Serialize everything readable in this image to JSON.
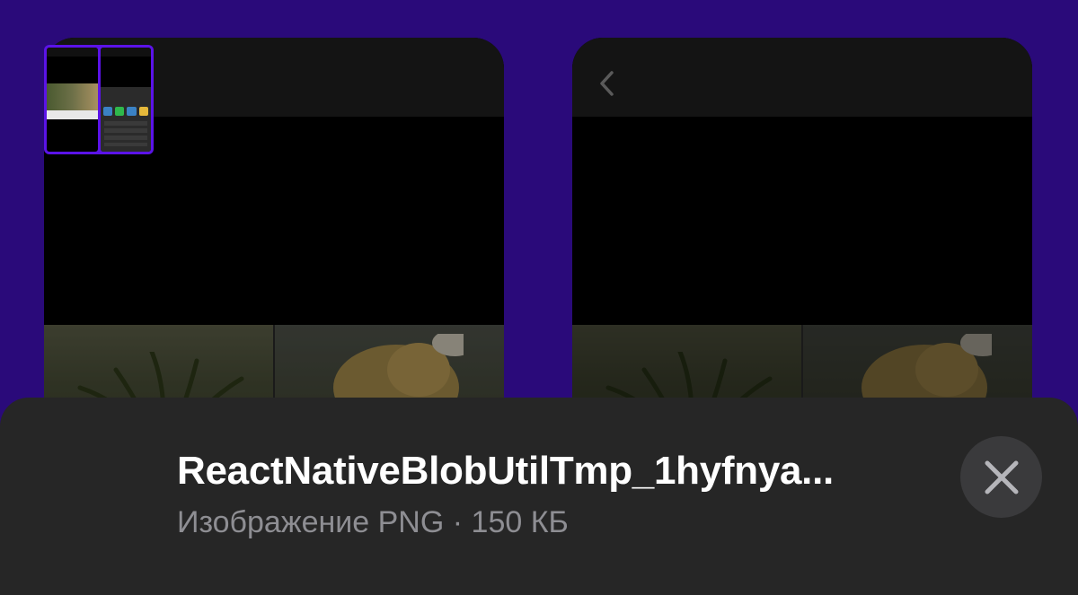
{
  "share_sheet": {
    "file_name": "ReactNativeBlobUtilTmp_1hyfnya...",
    "file_type": "Изображение PNG",
    "separator": "·",
    "file_size": "150 КБ",
    "close_icon": "close-icon",
    "thumbnail_border_color": "#5b13e8"
  },
  "background": {
    "color": "#2a0a7a",
    "previews": [
      {
        "back_icon": "chevron-left-icon"
      },
      {
        "back_icon": "chevron-left-icon"
      }
    ]
  }
}
